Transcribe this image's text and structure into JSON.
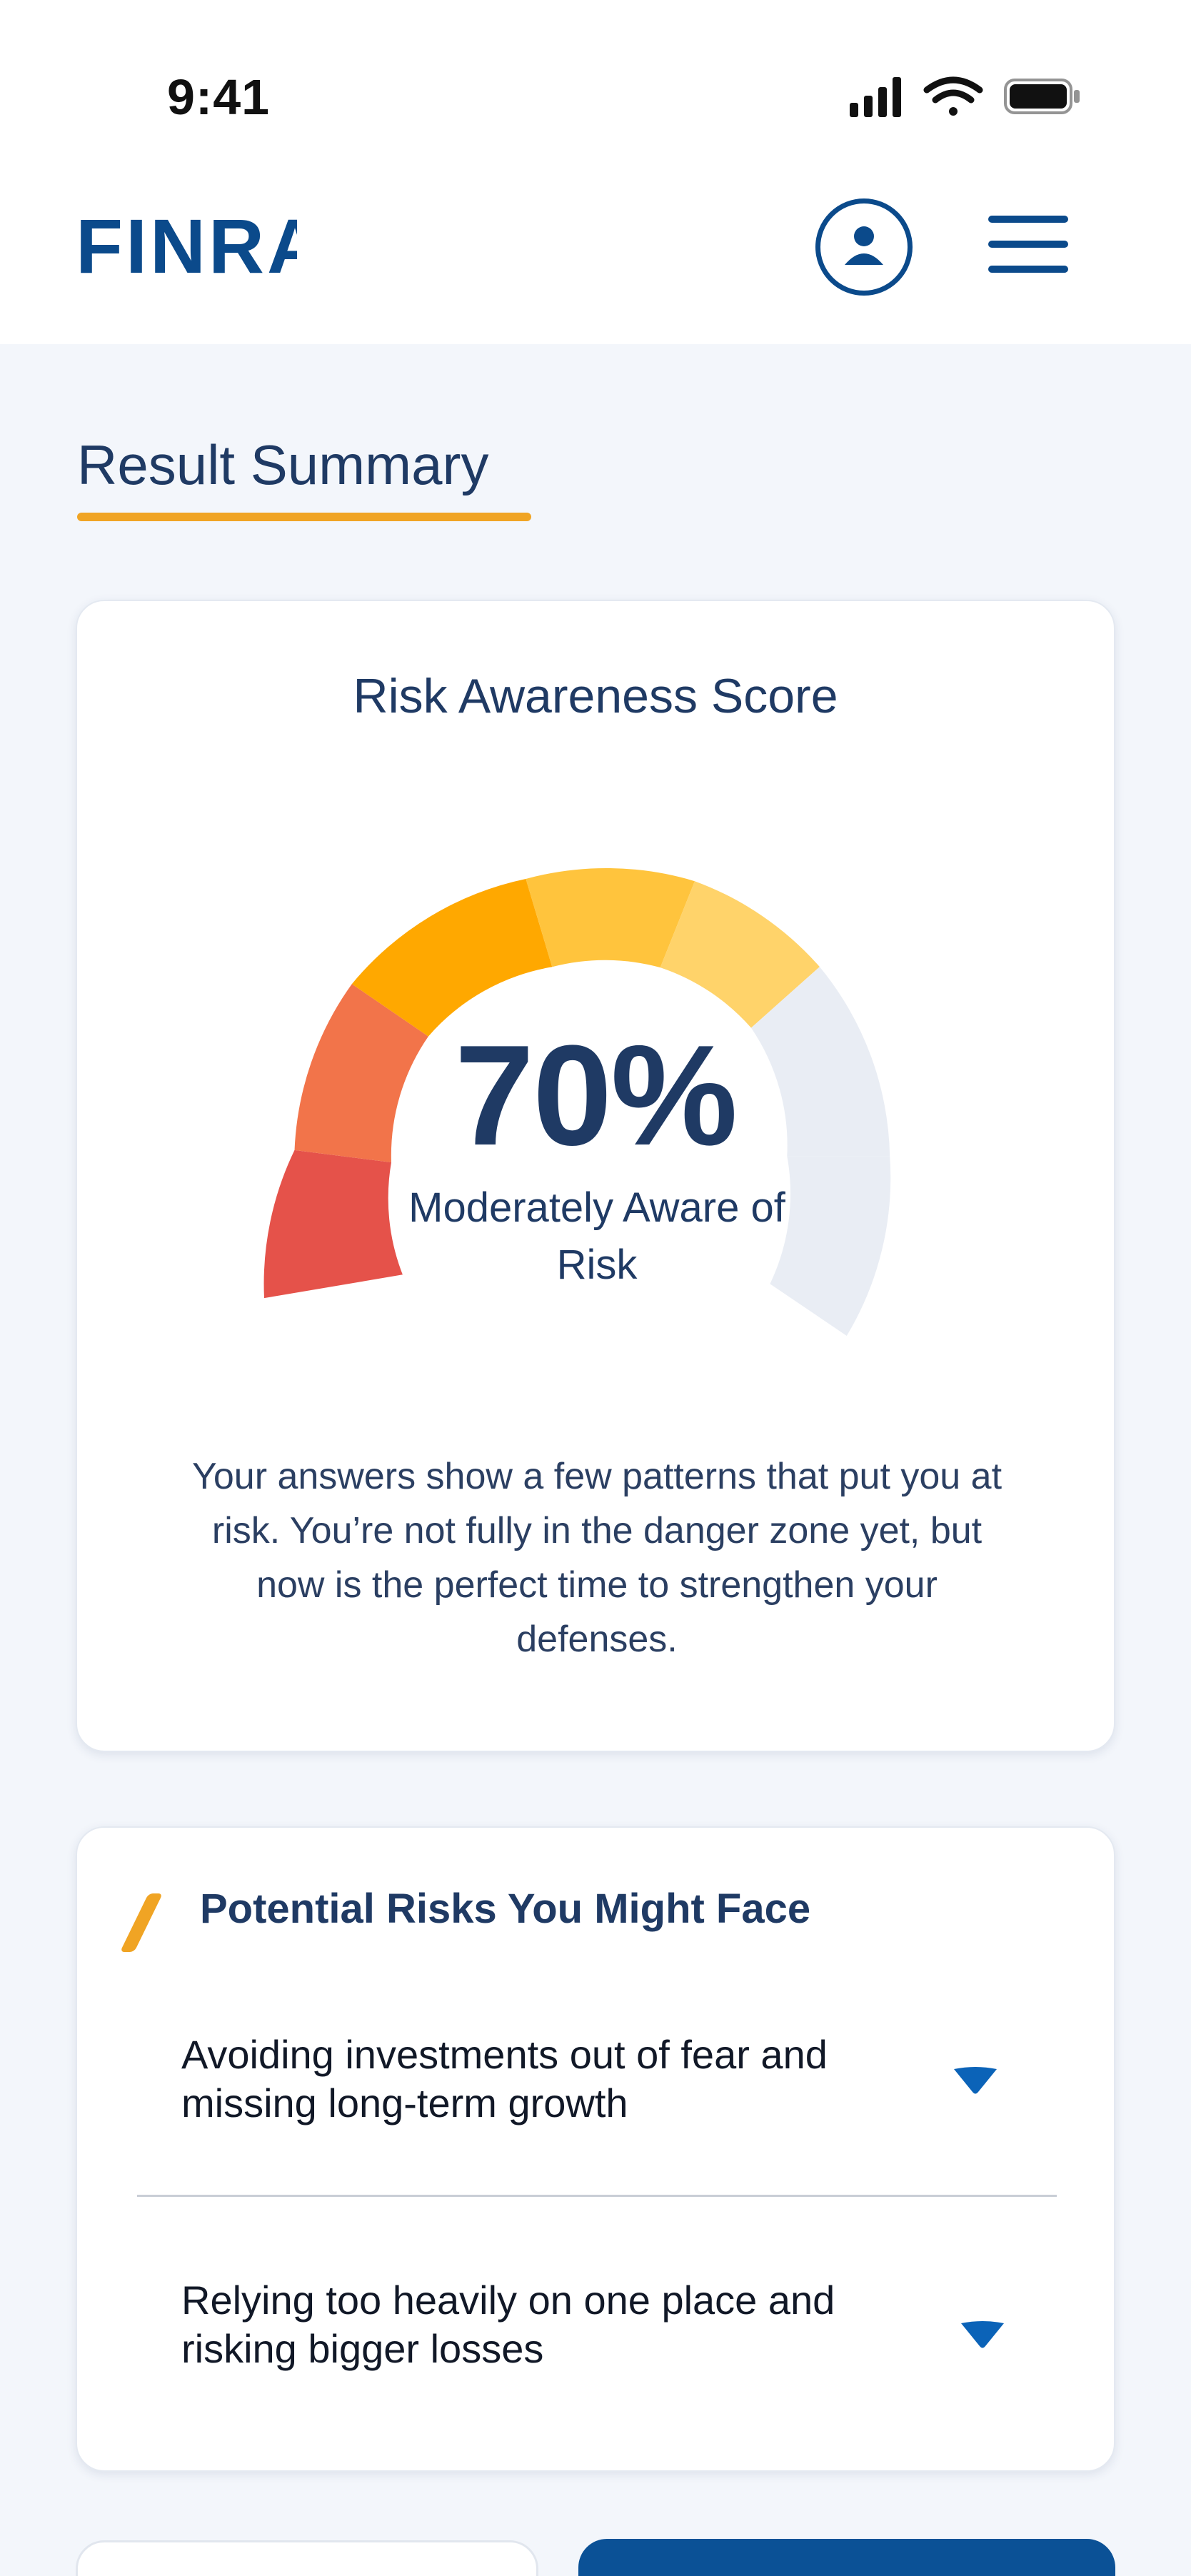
{
  "status_bar": {
    "time": "9:41",
    "icons": [
      "signal-icon",
      "wifi-icon",
      "battery-icon"
    ]
  },
  "header": {
    "logo_text": "FINRA",
    "profile_icon": "user-icon",
    "menu_icon": "hamburger-menu-icon"
  },
  "section": {
    "title": "Result Summary"
  },
  "score_card": {
    "title": "Risk Awareness Score",
    "value": "70%",
    "score_fraction": 0.7,
    "label": "Moderately Aware of Risk",
    "description": "Your answers show a few patterns that put you at risk. You’re not fully in the danger zone yet, but now is the perfect time to strengthen your defenses."
  },
  "risks_card": {
    "title": "Potential Risks You Might Face",
    "items": [
      {
        "label": "Avoiding investments out of fear and missing long-term growth",
        "icon": "chevron-down-icon"
      },
      {
        "label": "Relying too heavily on one place and risking bigger losses",
        "icon": "chevron-down-icon"
      }
    ]
  },
  "colors": {
    "brand_blue": "#0b4a8b",
    "accent_orange": "#f0a424",
    "gauge_segments": [
      "#e5524a",
      "#f2744a",
      "#ffa800",
      "#ffc43d",
      "#ffd36a",
      "#e9edf4",
      "#e9edf4"
    ]
  }
}
